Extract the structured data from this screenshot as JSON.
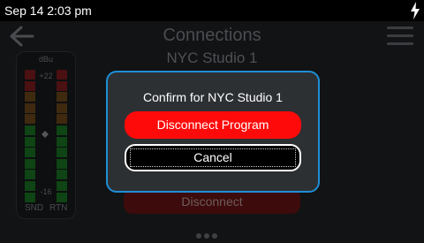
{
  "status": {
    "time": "Sep 14 2:03 pm",
    "charging_icon": "lightning-bolt-icon"
  },
  "header": {
    "title": "Connections",
    "subtitle": "NYC Studio 1",
    "back_icon": "back-arrow-icon",
    "menu_icon": "hamburger-menu-icon"
  },
  "meter": {
    "unit": "dBu",
    "top_label": "+22",
    "bottom_label": "-16",
    "channel_left": "SND",
    "channel_right": "RTN"
  },
  "background_button": {
    "label": "Disconnect"
  },
  "dialog": {
    "title": "Confirm for NYC Studio 1",
    "primary_label": "Disconnect Program",
    "cancel_label": "Cancel"
  },
  "pager": {
    "pages": 3,
    "current": 1
  },
  "colors": {
    "accent_border": "#1f8fd6",
    "danger": "#ff0a0a",
    "background": "#111315"
  }
}
